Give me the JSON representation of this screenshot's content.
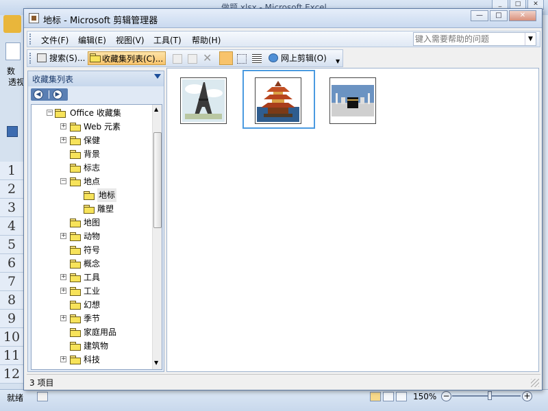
{
  "excel": {
    "title": "做题.xlsx - Microsoft Excel",
    "status": "就绪",
    "zoom": "150%",
    "row_numbers": [
      "1",
      "2",
      "3",
      "4",
      "5",
      "6",
      "7",
      "8",
      "9",
      "10",
      "11",
      "12"
    ],
    "left_strip": [
      "数",
      "透视"
    ]
  },
  "dialog": {
    "title": "地标 - Microsoft 剪辑管理器",
    "window_controls": {
      "min": "—",
      "max": "□",
      "close": "✕"
    },
    "menu": [
      "文件(F)",
      "编辑(E)",
      "视图(V)",
      "工具(T)",
      "帮助(H)"
    ],
    "help_placeholder": "键入需要帮助的问题",
    "toolbar": {
      "search": "搜索(S)...",
      "collection_list": "收藏集列表(C)...",
      "online_clips": "网上剪辑(O)"
    },
    "left_pane_title": "收藏集列表",
    "tree": [
      {
        "label": "Office 收藏集",
        "level": 0,
        "expander": "−"
      },
      {
        "label": "Web 元素",
        "level": 1,
        "expander": "+"
      },
      {
        "label": "保健",
        "level": 1,
        "expander": "+"
      },
      {
        "label": "背景",
        "level": 1,
        "expander": ""
      },
      {
        "label": "标志",
        "level": 1,
        "expander": ""
      },
      {
        "label": "地点",
        "level": 1,
        "expander": "−"
      },
      {
        "label": "地标",
        "level": 2,
        "expander": "",
        "selected": true
      },
      {
        "label": "雕塑",
        "level": 2,
        "expander": ""
      },
      {
        "label": "地图",
        "level": 1,
        "expander": ""
      },
      {
        "label": "动物",
        "level": 1,
        "expander": "+"
      },
      {
        "label": "符号",
        "level": 1,
        "expander": ""
      },
      {
        "label": "概念",
        "level": 1,
        "expander": ""
      },
      {
        "label": "工具",
        "level": 1,
        "expander": "+"
      },
      {
        "label": "工业",
        "level": 1,
        "expander": "+"
      },
      {
        "label": "幻想",
        "level": 1,
        "expander": ""
      },
      {
        "label": "季节",
        "level": 1,
        "expander": "+"
      },
      {
        "label": "家庭用品",
        "level": 1,
        "expander": ""
      },
      {
        "label": "建筑物",
        "level": 1,
        "expander": ""
      },
      {
        "label": "科技",
        "level": 1,
        "expander": "+"
      }
    ],
    "clips": [
      "eiffel-tower",
      "pagoda",
      "kaaba"
    ],
    "status": "3 项目"
  },
  "colors": {
    "accent": "#4a9ae0",
    "toolbar_active": "#f8c36b",
    "title_bg": "#c9d9ef"
  }
}
